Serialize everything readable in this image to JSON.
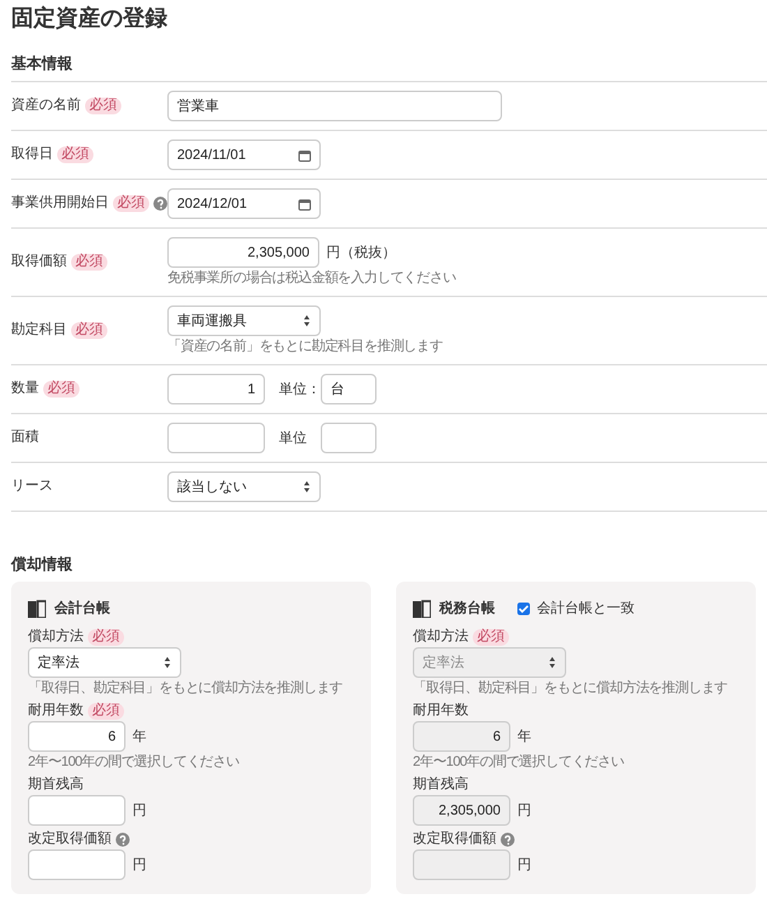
{
  "title": "固定資産の登録",
  "basic": {
    "heading": "基本情報",
    "rows": [
      {
        "label": "資産の名前",
        "badge": "必須",
        "kind": "text",
        "value": "営業車"
      },
      {
        "label": "取得日",
        "badge": "必須",
        "kind": "date",
        "value": "2024/11/01"
      },
      {
        "label": "事業供用開始日",
        "badge": "必須",
        "help": true,
        "kind": "date",
        "value": "2024/12/01"
      },
      {
        "label": "取得価額",
        "badge": "必須",
        "kind": "amount",
        "value": "2,305,000",
        "suffix": "円（税抜）",
        "hint": "免税事業所の場合は税込金額を入力してください"
      },
      {
        "label": "勘定科目",
        "badge": "必須",
        "kind": "select",
        "value": "車両運搬具",
        "hint": "「資産の名前」をもとに勘定科目を推測します"
      },
      {
        "label": "数量",
        "badge": "必須",
        "kind": "unit",
        "value": "1",
        "unit_label": "単位：",
        "unit_value": "台"
      },
      {
        "label": "面積",
        "kind": "unit",
        "unit_label": "単位"
      },
      {
        "label": "リース",
        "kind": "select",
        "value": "該当しない"
      }
    ]
  },
  "depreciation": {
    "heading": "償却情報",
    "ledgers": [
      {
        "title": "会計台帳",
        "fields": [
          {
            "label": "償却方法",
            "badge": "必須",
            "kind": "select",
            "value": "定率法",
            "disabled": false,
            "hint": "「取得日、勘定科目」をもとに償却方法を推測します"
          },
          {
            "label": "耐用年数",
            "badge": "必須",
            "kind": "number",
            "value": "6",
            "suffix": "年",
            "disabled": false,
            "hint": "2年〜100年の間で選択してください"
          },
          {
            "label": "期首残高",
            "kind": "number",
            "suffix": "円",
            "disabled": false
          },
          {
            "label": "改定取得価額",
            "help": true,
            "kind": "number",
            "suffix": "円",
            "disabled": false
          }
        ]
      },
      {
        "title": "税務台帳",
        "sync": {
          "label": "会計台帳と一致",
          "checked": true
        },
        "fields": [
          {
            "label": "償却方法",
            "badge": "必須",
            "kind": "select",
            "value": "定率法",
            "disabled": true,
            "hint": "「取得日、勘定科目」をもとに償却方法を推測します"
          },
          {
            "label": "耐用年数",
            "kind": "number",
            "value": "6",
            "suffix": "年",
            "disabled": true,
            "hint": "2年〜100年の間で選択してください"
          },
          {
            "label": "期首残高",
            "kind": "number",
            "value": "2,305,000",
            "suffix": "円",
            "disabled": true
          },
          {
            "label": "改定取得価額",
            "help": true,
            "kind": "number",
            "suffix": "円",
            "disabled": true
          }
        ]
      }
    ]
  }
}
